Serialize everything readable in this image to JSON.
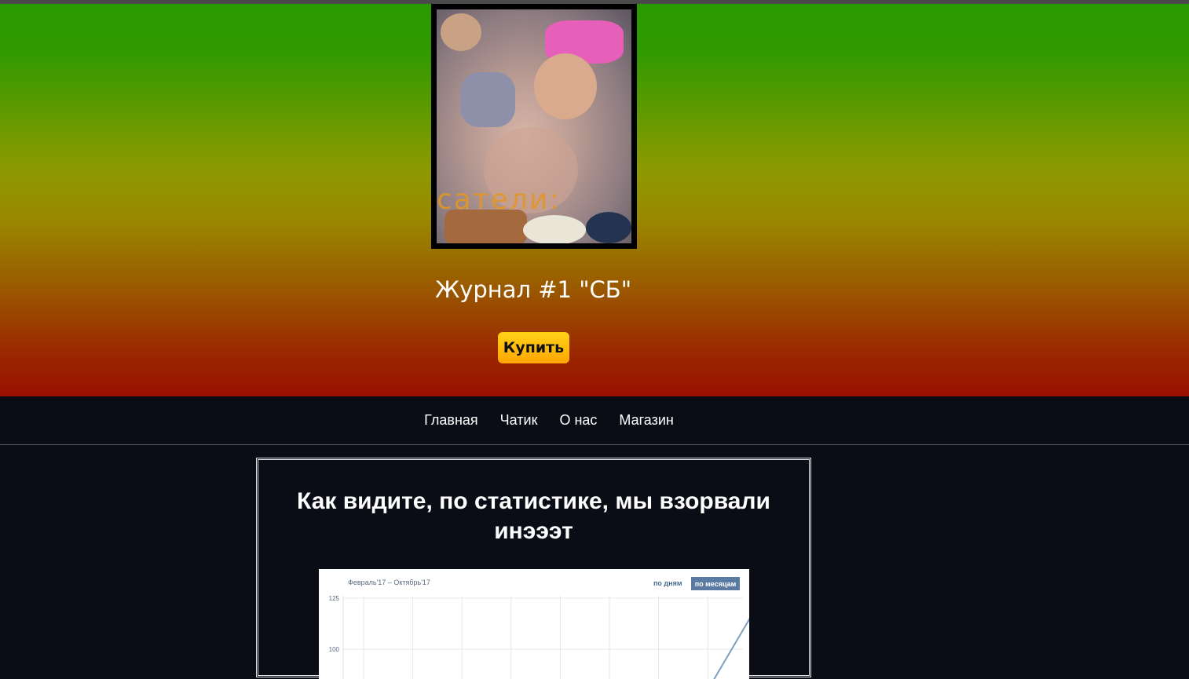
{
  "header": {
    "cover_alt": "Обложка журнала",
    "cover_text": "сатели:",
    "title": "Журнал #1 \"СБ\"",
    "buy_label": "Купить"
  },
  "nav": {
    "items": [
      "Главная",
      "Чатик",
      "О нас",
      "Магазин"
    ]
  },
  "main": {
    "heading": "Как видите, по статистике, мы взорвали инэээт"
  },
  "stats_widget": {
    "range_label": "Февраль'17 – Октябрь'17",
    "tab_days": "по дням",
    "tab_months": "по месяцам",
    "active_tab": "по месяцам"
  },
  "chart_data": {
    "type": "line",
    "y_ticks": [
      125,
      100
    ],
    "x_count": 9,
    "series": [
      {
        "values": [
          null,
          null,
          null,
          null,
          null,
          null,
          null,
          80,
          121
        ]
      }
    ],
    "grid": true,
    "colors": {
      "line": "#7fa0bd",
      "grid": "#e4e8ed"
    }
  }
}
